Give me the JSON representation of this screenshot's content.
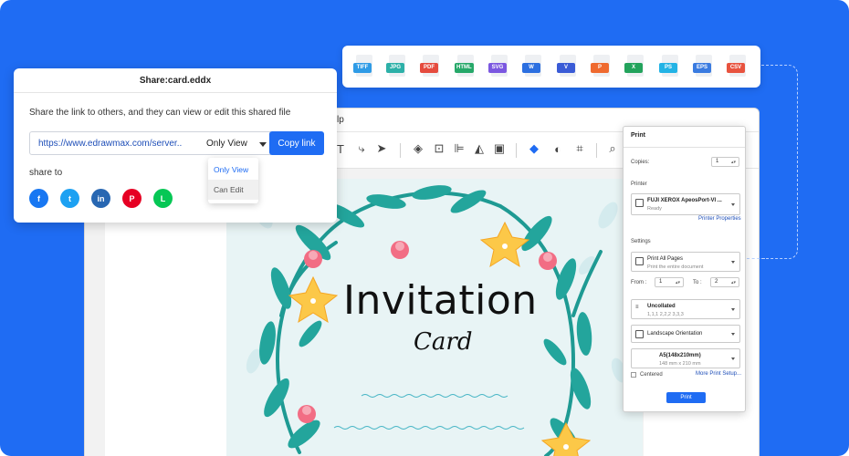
{
  "editor": {
    "help_menu_fragment": "lp"
  },
  "canvas": {
    "title": "Invitation",
    "subtitle": "Card"
  },
  "export_formats": [
    {
      "label": "TIFF",
      "color": "#2f9be6"
    },
    {
      "label": "JPG",
      "color": "#2db0a8"
    },
    {
      "label": "PDF",
      "color": "#e54b3e"
    },
    {
      "label": "HTML",
      "color": "#26a869"
    },
    {
      "label": "SVG",
      "color": "#7b57e0"
    },
    {
      "label": "W",
      "color": "#2c6fe0"
    },
    {
      "label": "V",
      "color": "#3a5bd6"
    },
    {
      "label": "P",
      "color": "#ef6a2f"
    },
    {
      "label": "X",
      "color": "#23a35c"
    },
    {
      "label": "PS",
      "color": "#23b3e5"
    },
    {
      "label": "EPS",
      "color": "#3a7be0"
    },
    {
      "label": "CSV",
      "color": "#e8533f"
    }
  ],
  "share_dialog": {
    "title": "Share:card.eddx",
    "description": "Share the link to others, and they can view or edit this shared file",
    "link_url": "https://www.edrawmax.com/server..",
    "permission": "Only View",
    "copy_label": "Copy link",
    "share_to_label": "share to",
    "dropdown_options": [
      "Only View",
      "Can Edit"
    ],
    "socials": [
      {
        "name": "facebook",
        "glyph": "f",
        "color": "#1877f2"
      },
      {
        "name": "twitter",
        "glyph": "t",
        "color": "#1da1f2"
      },
      {
        "name": "linkedin",
        "glyph": "in",
        "color": "#2867b2"
      },
      {
        "name": "pinterest",
        "glyph": "P",
        "color": "#e60023"
      },
      {
        "name": "line",
        "glyph": "L",
        "color": "#06c755"
      }
    ]
  },
  "print_dialog": {
    "title": "Print",
    "copies_label": "Copies:",
    "copies_value": "1",
    "printer_label": "Printer",
    "printer_name": "FUJI XEROX ApeosPort-VI ...",
    "printer_status": "Ready",
    "printer_properties": "Printer Properties",
    "settings_label": "Settings",
    "pages_title": "Print All Pages",
    "pages_sub": "Print the entire document",
    "from_label": "From :",
    "from_value": "1",
    "to_label": "To :",
    "to_value": "2",
    "collate_title": "Uncollated",
    "collate_sub": "1,1,1  2,2,2  3,3,3",
    "orientation": "Landscape Orientation",
    "paper_title": "A5(148x210mm)",
    "paper_sub": "148 mm x 210 mm",
    "centered_label": "Centered",
    "more_setup": "More Print Setup...",
    "print_button": "Print"
  }
}
